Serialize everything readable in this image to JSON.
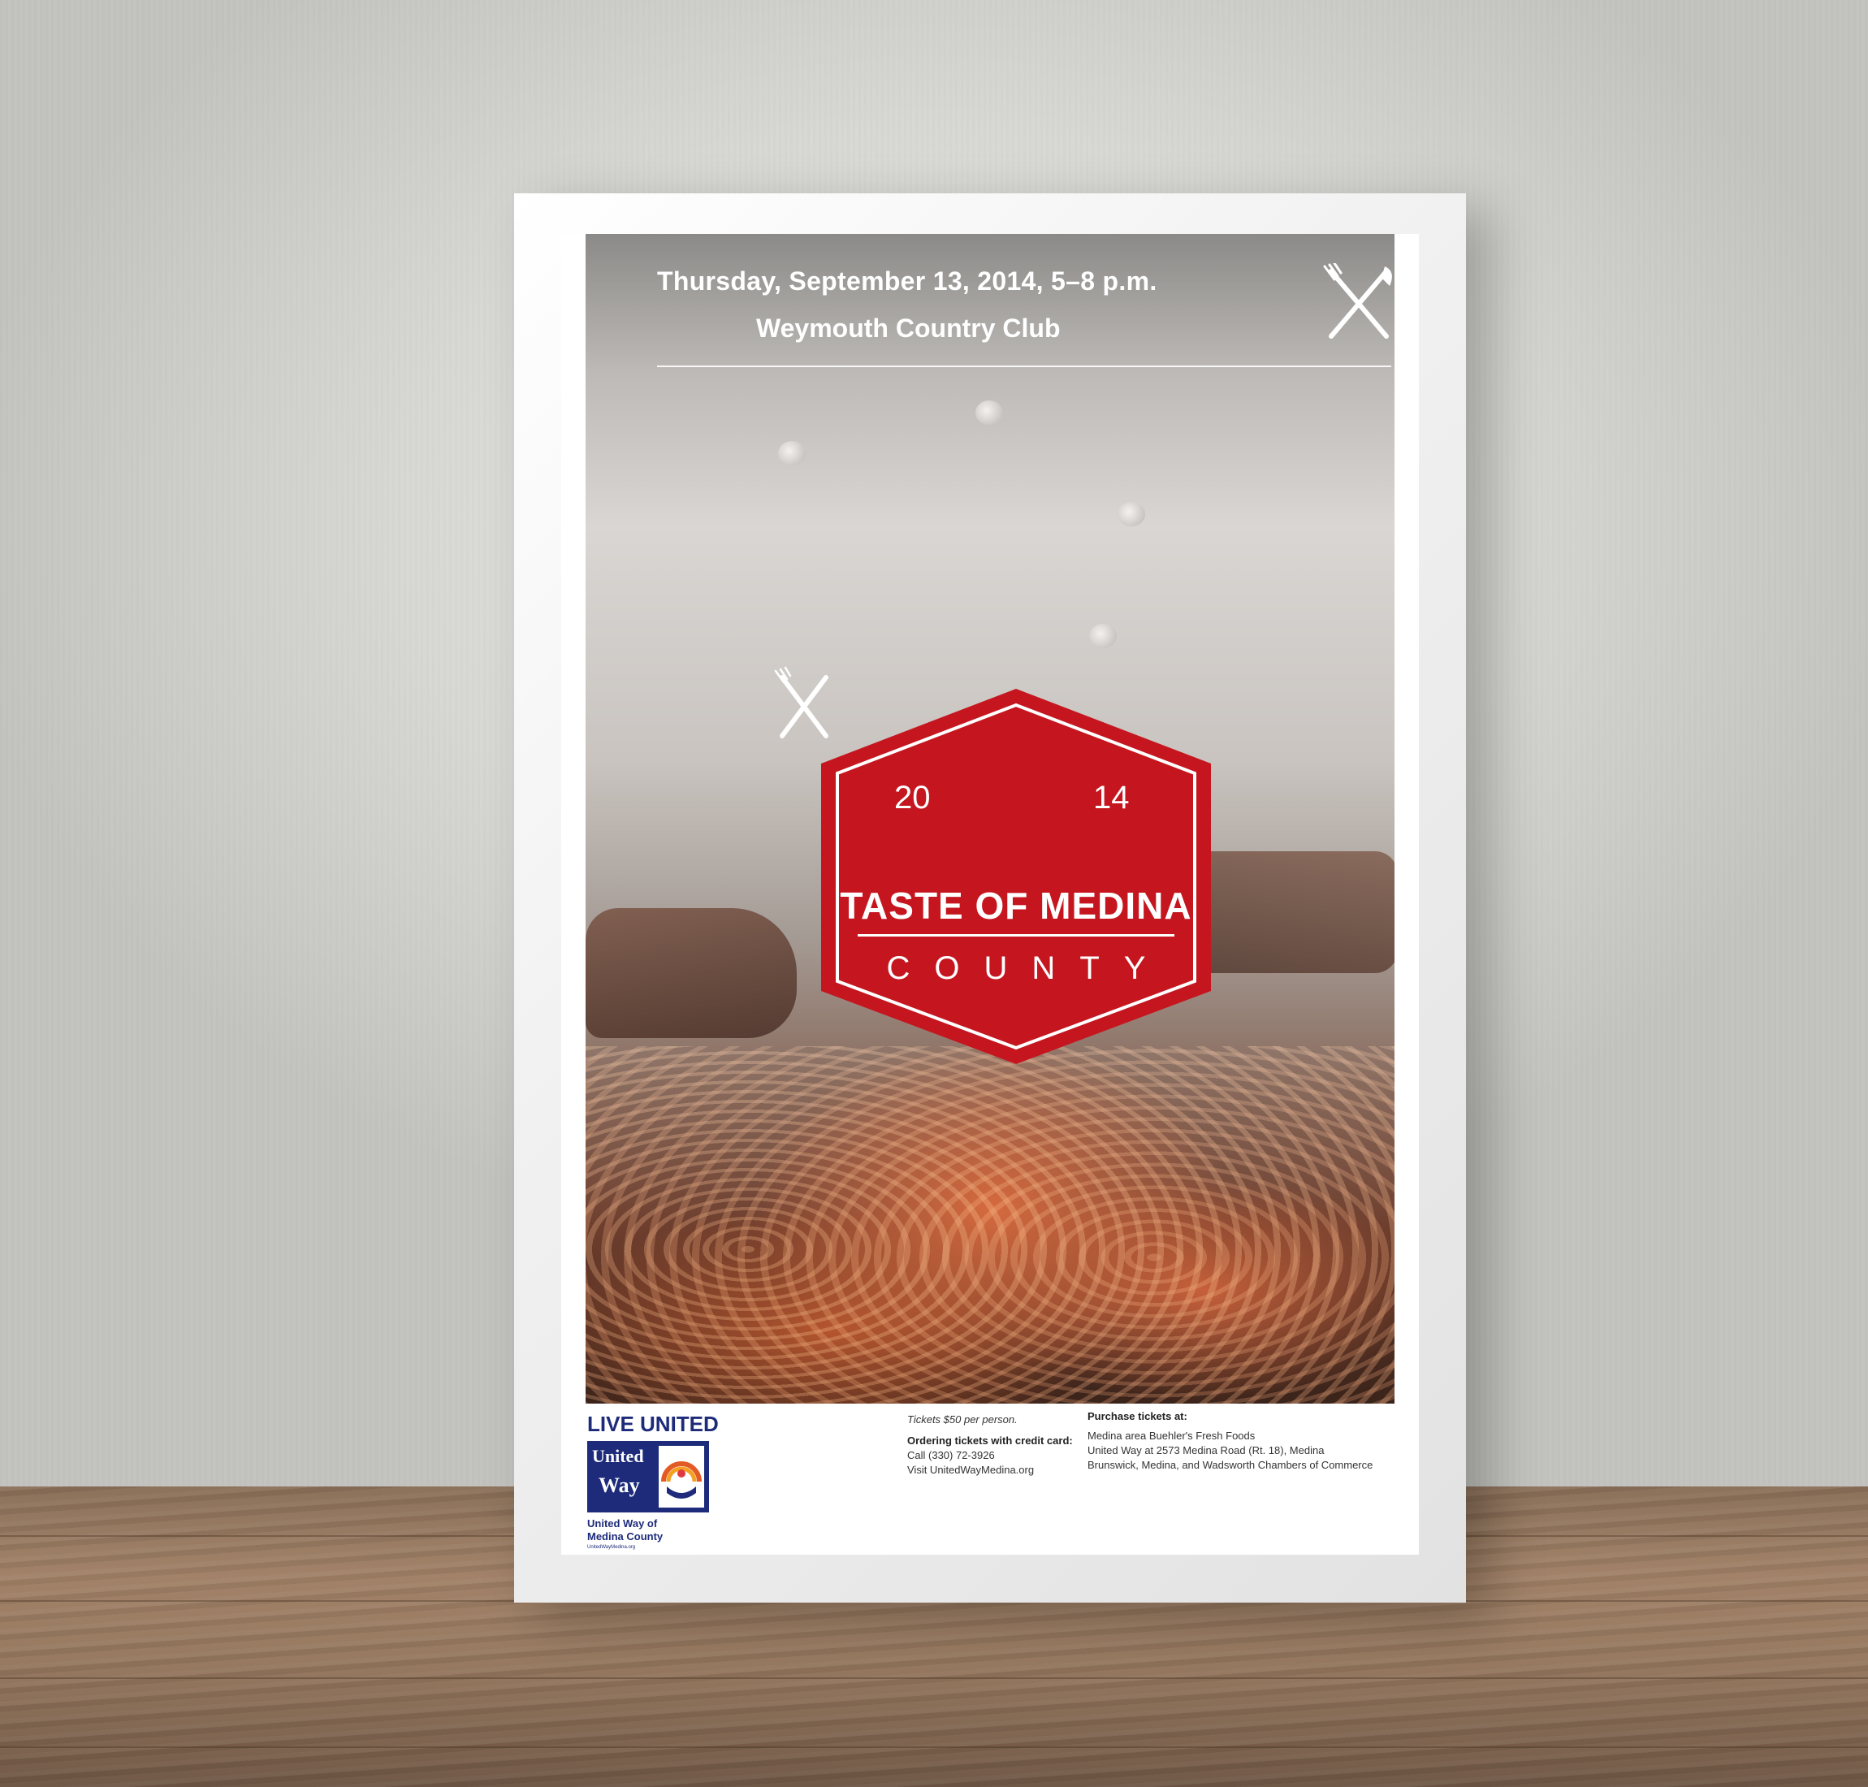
{
  "poster": {
    "date_line": "Thursday, September 13, 2014, 5–8 p.m.",
    "venue": "Weymouth Country Club",
    "icons": [
      "fork-knife-icon"
    ]
  },
  "badge": {
    "year_left": "20",
    "year_right": "14",
    "title": "TASTE OF MEDINA",
    "subtitle": "COUNTY",
    "color": "#c5161f"
  },
  "footer": {
    "brand": {
      "tagline": "LIVE UNITED",
      "logo_word1": "United",
      "logo_word2": "Way",
      "org_line1": "United Way of",
      "org_line2": "Medina County",
      "url": "UnitedWayMedina.org",
      "color": "#1d2b7a"
    },
    "price": "Tickets $50 per person.",
    "ordering_heading": "Ordering tickets with credit card:",
    "ordering_call": "Call (330) 72-3926",
    "ordering_visit": "Visit UnitedWayMedina.org",
    "purchase_heading": "Purchase tickets at:",
    "purchase_line1": "Medina area Buehler's Fresh Foods",
    "purchase_line2": "United Way at 2573 Medina Road (Rt. 18), Medina",
    "purchase_line3": "Brunswick, Medina, and Wadsworth Chambers of Commerce"
  }
}
